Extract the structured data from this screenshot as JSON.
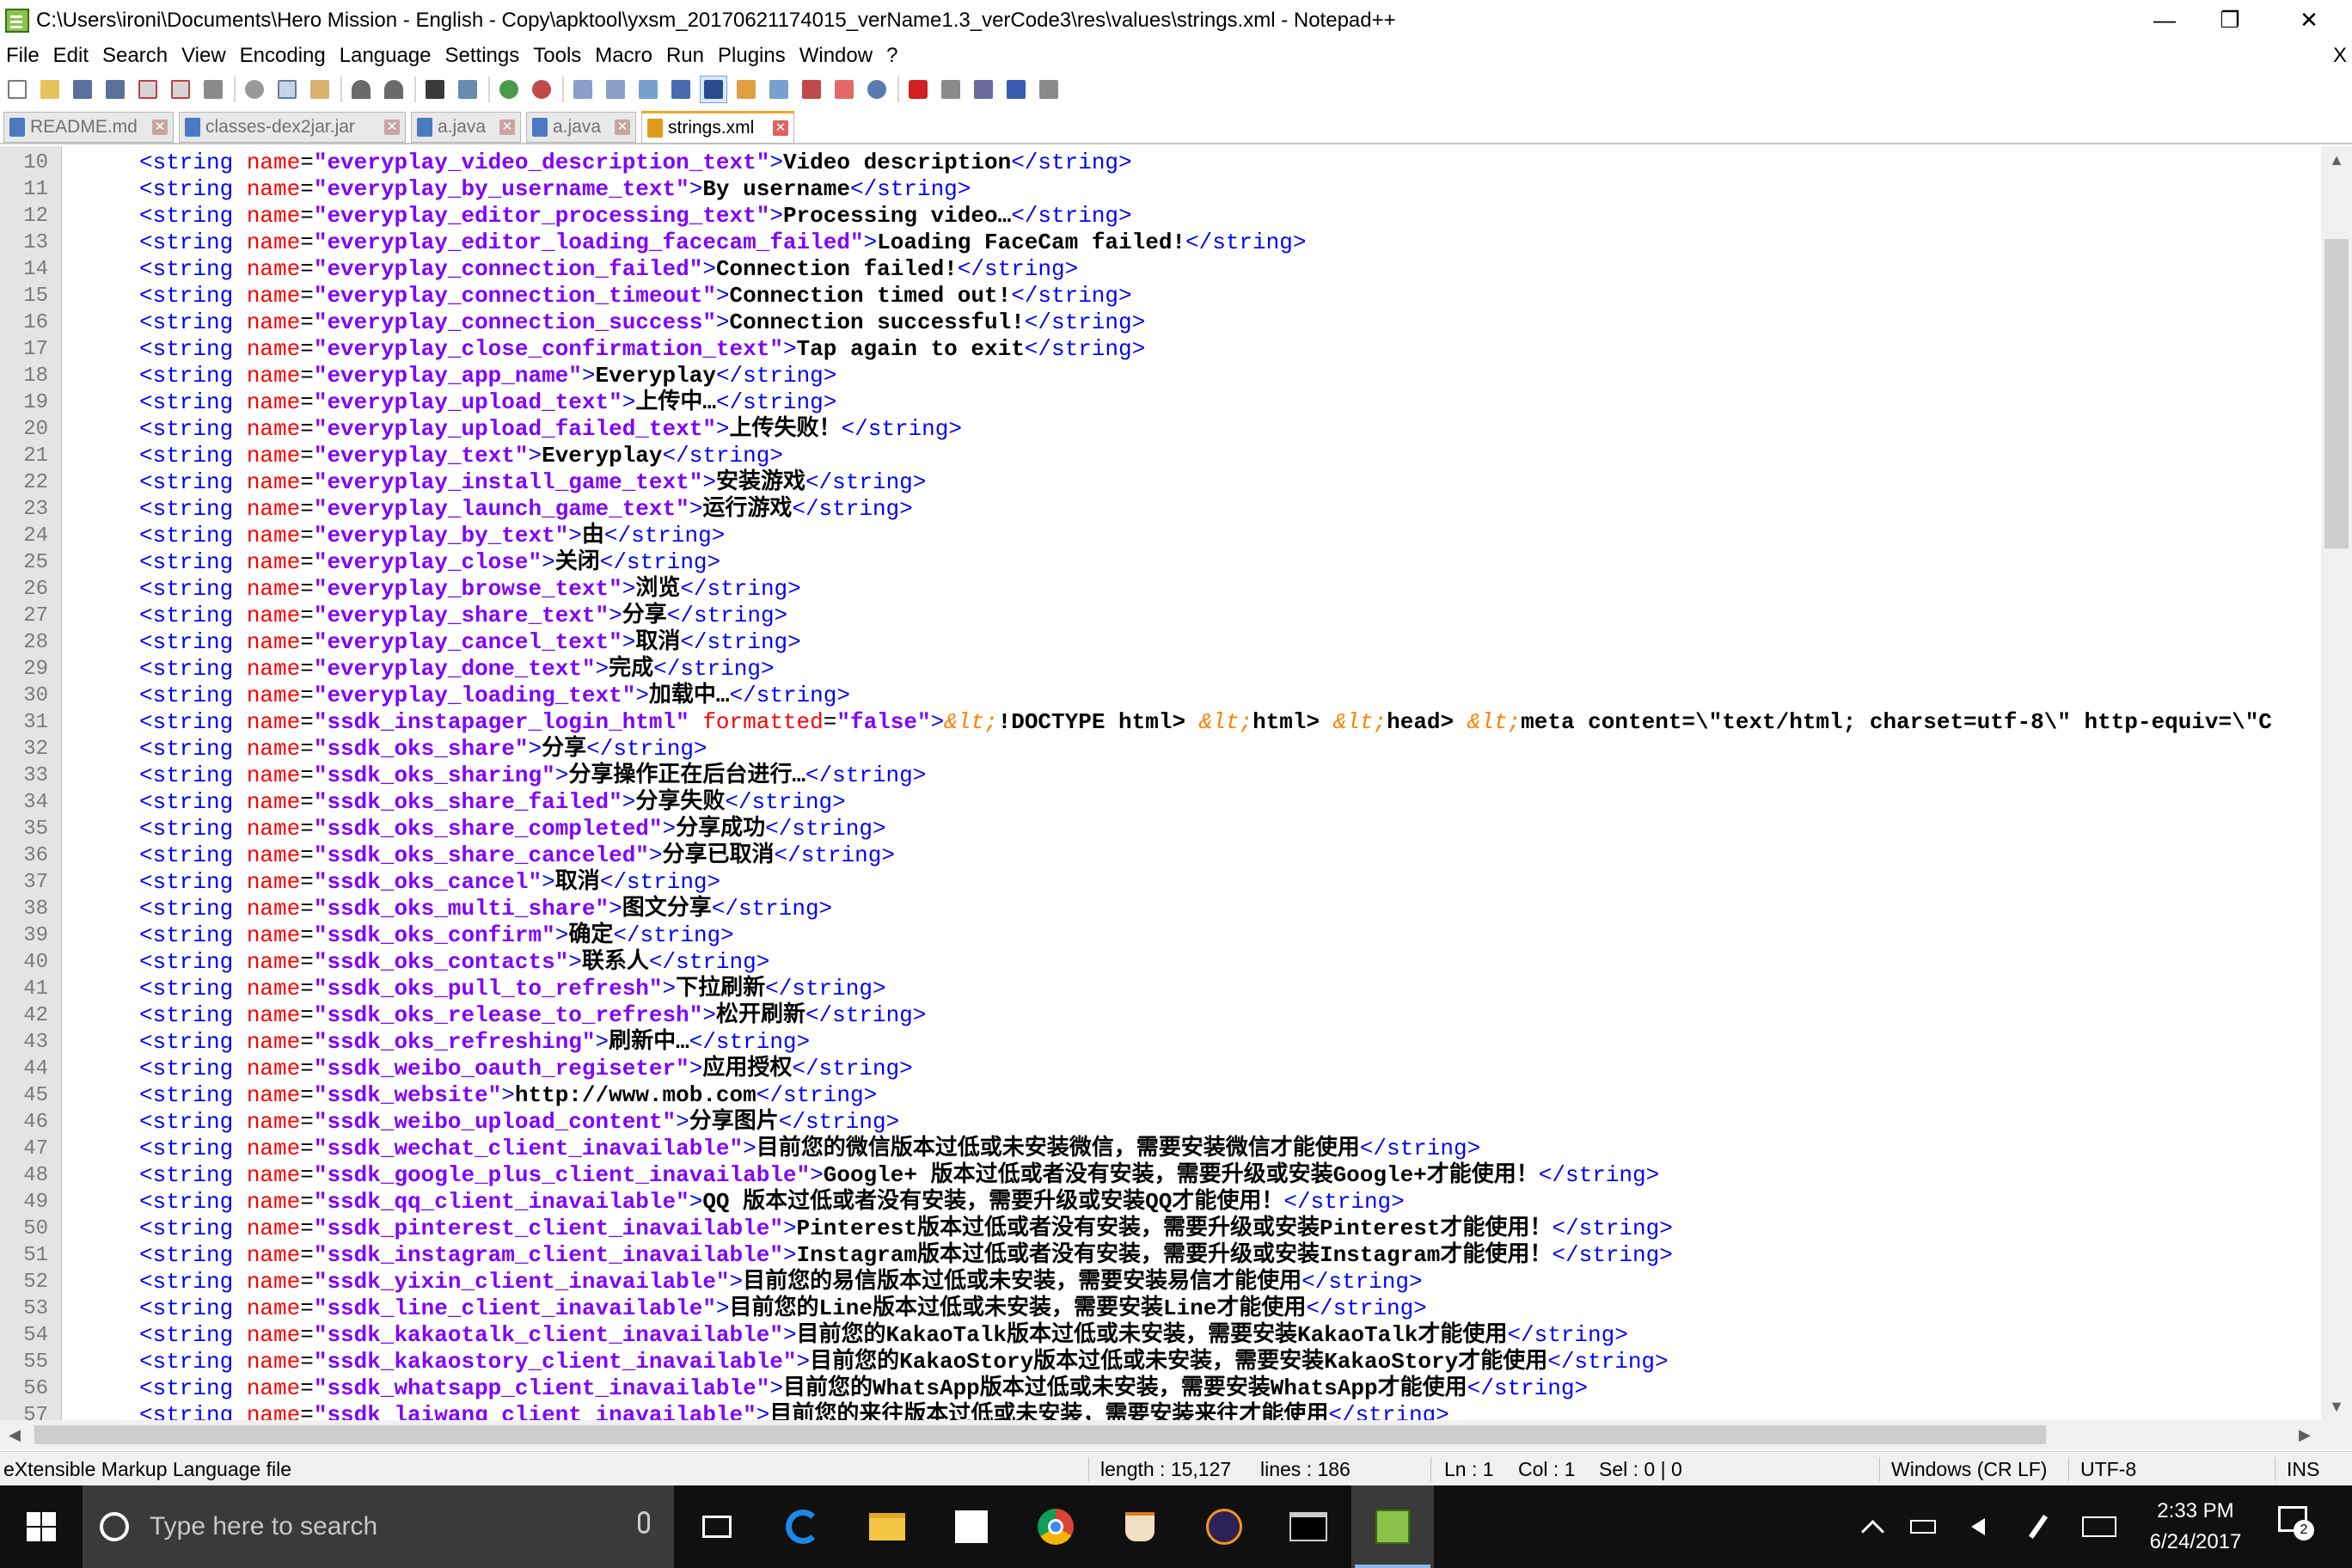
{
  "window": {
    "title": "C:\\Users\\ironi\\Documents\\Hero Mission - English - Copy\\apktool\\yxsm_20170621174015_verName1.3_verCode3\\res\\values\\strings.xml - Notepad++",
    "minimize": "—",
    "restore": "❐",
    "close": "✕"
  },
  "menu": [
    "File",
    "Edit",
    "Search",
    "View",
    "Encoding",
    "Language",
    "Settings",
    "Tools",
    "Macro",
    "Run",
    "Plugins",
    "Window",
    "?"
  ],
  "menu_close": "X",
  "tabs": [
    {
      "label": "README.md",
      "active": false
    },
    {
      "label": "classes-dex2jar.jar",
      "active": false
    },
    {
      "label": "a.java",
      "active": false
    },
    {
      "label": "a.java",
      "active": false
    },
    {
      "label": "strings.xml",
      "active": true
    }
  ],
  "tab_close": "✕",
  "editor": {
    "lines": [
      {
        "n": "10",
        "name": "everyplay_video_description_text",
        "text": "Video description"
      },
      {
        "n": "11",
        "name": "everyplay_by_username_text",
        "text": "By username"
      },
      {
        "n": "12",
        "name": "everyplay_editor_processing_text",
        "text": "Processing video…"
      },
      {
        "n": "13",
        "name": "everyplay_editor_loading_facecam_failed",
        "text": "Loading FaceCam failed!"
      },
      {
        "n": "14",
        "name": "everyplay_connection_failed",
        "text": "Connection failed!"
      },
      {
        "n": "15",
        "name": "everyplay_connection_timeout",
        "text": "Connection timed out!"
      },
      {
        "n": "16",
        "name": "everyplay_connection_success",
        "text": "Connection successful!"
      },
      {
        "n": "17",
        "name": "everyplay_close_confirmation_text",
        "text": "Tap again to exit"
      },
      {
        "n": "18",
        "name": "everyplay_app_name",
        "text": "Everyplay"
      },
      {
        "n": "19",
        "name": "everyplay_upload_text",
        "text": "上传中…"
      },
      {
        "n": "20",
        "name": "everyplay_upload_failed_text",
        "text": "上传失败！"
      },
      {
        "n": "21",
        "name": "everyplay_text",
        "text": "Everyplay"
      },
      {
        "n": "22",
        "name": "everyplay_install_game_text",
        "text": "安装游戏"
      },
      {
        "n": "23",
        "name": "everyplay_launch_game_text",
        "text": "运行游戏"
      },
      {
        "n": "24",
        "name": "everyplay_by_text",
        "text": "由"
      },
      {
        "n": "25",
        "name": "everyplay_close",
        "text": "关闭"
      },
      {
        "n": "26",
        "name": "everyplay_browse_text",
        "text": "浏览"
      },
      {
        "n": "27",
        "name": "everyplay_share_text",
        "text": "分享"
      },
      {
        "n": "28",
        "name": "everyplay_cancel_text",
        "text": "取消"
      },
      {
        "n": "29",
        "name": "everyplay_done_text",
        "text": "完成"
      },
      {
        "n": "30",
        "name": "everyplay_loading_text",
        "text": "加载中…"
      },
      {
        "n": "31",
        "name": "ssdk_instapager_login_html",
        "attr2": "formatted",
        "val2": "false",
        "special": "ssdk_html"
      },
      {
        "n": "32",
        "name": "ssdk_oks_share",
        "text": "分享"
      },
      {
        "n": "33",
        "name": "ssdk_oks_sharing",
        "text": "分享操作正在后台进行…"
      },
      {
        "n": "34",
        "name": "ssdk_oks_share_failed",
        "text": "分享失败"
      },
      {
        "n": "35",
        "name": "ssdk_oks_share_completed",
        "text": "分享成功"
      },
      {
        "n": "36",
        "name": "ssdk_oks_share_canceled",
        "text": "分享已取消"
      },
      {
        "n": "37",
        "name": "ssdk_oks_cancel",
        "text": "取消"
      },
      {
        "n": "38",
        "name": "ssdk_oks_multi_share",
        "text": "图文分享"
      },
      {
        "n": "39",
        "name": "ssdk_oks_confirm",
        "text": "确定"
      },
      {
        "n": "40",
        "name": "ssdk_oks_contacts",
        "text": "联系人"
      },
      {
        "n": "41",
        "name": "ssdk_oks_pull_to_refresh",
        "text": "下拉刷新"
      },
      {
        "n": "42",
        "name": "ssdk_oks_release_to_refresh",
        "text": "松开刷新"
      },
      {
        "n": "43",
        "name": "ssdk_oks_refreshing",
        "text": "刷新中…"
      },
      {
        "n": "44",
        "name": "ssdk_weibo_oauth_regiseter",
        "text": "应用授权"
      },
      {
        "n": "45",
        "name": "ssdk_website",
        "text": "http://www.mob.com"
      },
      {
        "n": "46",
        "name": "ssdk_weibo_upload_content",
        "text": "分享图片"
      },
      {
        "n": "47",
        "name": "ssdk_wechat_client_inavailable",
        "text": "目前您的微信版本过低或未安装微信，需要安装微信才能使用"
      },
      {
        "n": "48",
        "name": "ssdk_google_plus_client_inavailable",
        "text": "Google+ 版本过低或者没有安装，需要升级或安装Google+才能使用！"
      },
      {
        "n": "49",
        "name": "ssdk_qq_client_inavailable",
        "text": "QQ 版本过低或者没有安装，需要升级或安装QQ才能使用！"
      },
      {
        "n": "50",
        "name": "ssdk_pinterest_client_inavailable",
        "text": "Pinterest版本过低或者没有安装，需要升级或安装Pinterest才能使用！"
      },
      {
        "n": "51",
        "name": "ssdk_instagram_client_inavailable",
        "text": "Instagram版本过低或者没有安装，需要升级或安装Instagram才能使用！"
      },
      {
        "n": "52",
        "name": "ssdk_yixin_client_inavailable",
        "text": "目前您的易信版本过低或未安装，需要安装易信才能使用"
      },
      {
        "n": "53",
        "name": "ssdk_line_client_inavailable",
        "text": "目前您的Line版本过低或未安装，需要安装Line才能使用"
      },
      {
        "n": "54",
        "name": "ssdk_kakaotalk_client_inavailable",
        "text": "目前您的KakaoTalk版本过低或未安装，需要安装KakaoTalk才能使用"
      },
      {
        "n": "55",
        "name": "ssdk_kakaostory_client_inavailable",
        "text": "目前您的KakaoStory版本过低或未安装，需要安装KakaoStory才能使用"
      },
      {
        "n": "56",
        "name": "ssdk_whatsapp_client_inavailable",
        "text": "目前您的WhatsApp版本过低或未安装，需要安装WhatsApp才能使用"
      },
      {
        "n": "57",
        "name": "ssdk_laiwang_client_inavailable",
        "text": "目前您的来往版本过低或未安装，需要安装来往才能使用"
      }
    ],
    "line31_html": [
      {
        "t": "ent",
        "s": "&lt;"
      },
      {
        "t": "txt",
        "s": "!DOCTYPE html> "
      },
      {
        "t": "ent",
        "s": "&lt;"
      },
      {
        "t": "txt",
        "s": "html> "
      },
      {
        "t": "ent",
        "s": "&lt;"
      },
      {
        "t": "txt",
        "s": "head> "
      },
      {
        "t": "ent",
        "s": "&lt;"
      },
      {
        "t": "txt",
        "s": "meta content=\\\"text/html; charset=utf-8\\\" http-equiv=\\\"C"
      }
    ]
  },
  "scroll": {
    "up": "▲",
    "down": "▼",
    "left": "◀",
    "right": "▶"
  },
  "status": {
    "file_type": "eXtensible Markup Language file",
    "length": "length : 15,127",
    "lines": "lines : 186",
    "ln": "Ln : 1",
    "col": "Col : 1",
    "sel": "Sel : 0 | 0",
    "eol": "Windows (CR LF)",
    "encoding": "UTF-8",
    "mode": "INS"
  },
  "taskbar": {
    "search_placeholder": "Type here to search",
    "time": "2:33 PM",
    "date": "6/24/2017",
    "notification_count": "2"
  },
  "colors": {
    "tag": "#0000ff",
    "attribute": "#ff0000",
    "attribute_value": "#8000ff",
    "entity": "#ff8000",
    "active_tab_accent": "#f7a526"
  }
}
